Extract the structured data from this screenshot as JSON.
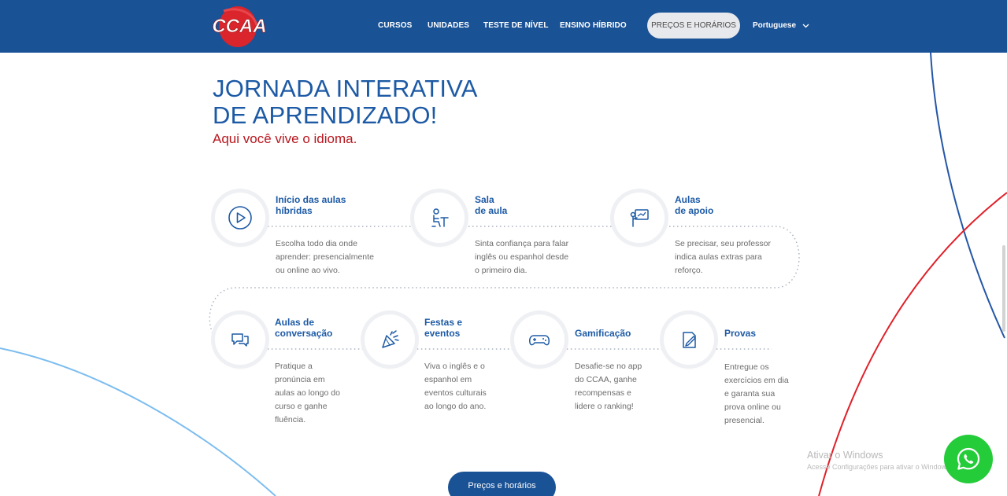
{
  "header": {
    "logo_text": "CCAA",
    "nav": [
      "CURSOS",
      "UNIDADES",
      "TESTE DE NÍVEL",
      "ENSINO HÍBRIDO"
    ],
    "pricing_button": "PREÇOS E HORÁRIOS",
    "language": "Portuguese"
  },
  "hero": {
    "title_line1": "JORNADA INTERATIVA",
    "title_line2": "DE APRENDIZADO!",
    "subtitle": "Aqui você vive o idioma."
  },
  "steps": [
    {
      "title": [
        "Início das aulas",
        "híbridas"
      ],
      "desc": [
        "Escolha todo dia onde",
        "aprender: presencialmente",
        "ou online ao vivo."
      ],
      "icon": "play-icon"
    },
    {
      "title": [
        "Sala",
        "de aula"
      ],
      "desc": [
        "Sinta confiança para falar",
        "inglês ou espanhol desde",
        "o primeiro dia."
      ],
      "icon": "classroom-icon"
    },
    {
      "title": [
        "Aulas",
        "de apoio"
      ],
      "desc": [
        "Se precisar, seu professor",
        "indica aulas extras para",
        "reforço."
      ],
      "icon": "teacher-board-icon"
    },
    {
      "title": [
        "Aulas de",
        "conversação"
      ],
      "desc": [
        "Pratique a",
        "pronúncia em",
        "aulas ao longo do",
        "curso e ganhe",
        "fluência."
      ],
      "icon": "chat-bubbles-icon"
    },
    {
      "title": [
        "Festas e",
        "eventos"
      ],
      "desc": [
        "Viva o inglês e o",
        "espanhol em",
        "eventos culturais",
        "ao longo do ano."
      ],
      "icon": "party-popper-icon"
    },
    {
      "title": [
        "Gamificação"
      ],
      "desc": [
        "Desafie-se no app",
        "do CCAA, ganhe",
        "recompensas e",
        "lidere o ranking!"
      ],
      "icon": "gamepad-icon"
    },
    {
      "title": [
        "Provas"
      ],
      "desc": [
        "Entregue os",
        "exercícios em dia",
        "e garanta sua",
        "prova online ou",
        "presencial."
      ],
      "icon": "test-paper-icon"
    }
  ],
  "cta": {
    "label": "Preços e horários"
  },
  "watermark": {
    "title": "Ativar o Windows",
    "subtitle": "Acesse Configurações para ativar o Windows."
  },
  "colors": {
    "brand_blue": "#1a5296",
    "title_blue": "#1d5aa5",
    "accent_red": "#b8161e",
    "whatsapp_green": "#25cc3a"
  }
}
